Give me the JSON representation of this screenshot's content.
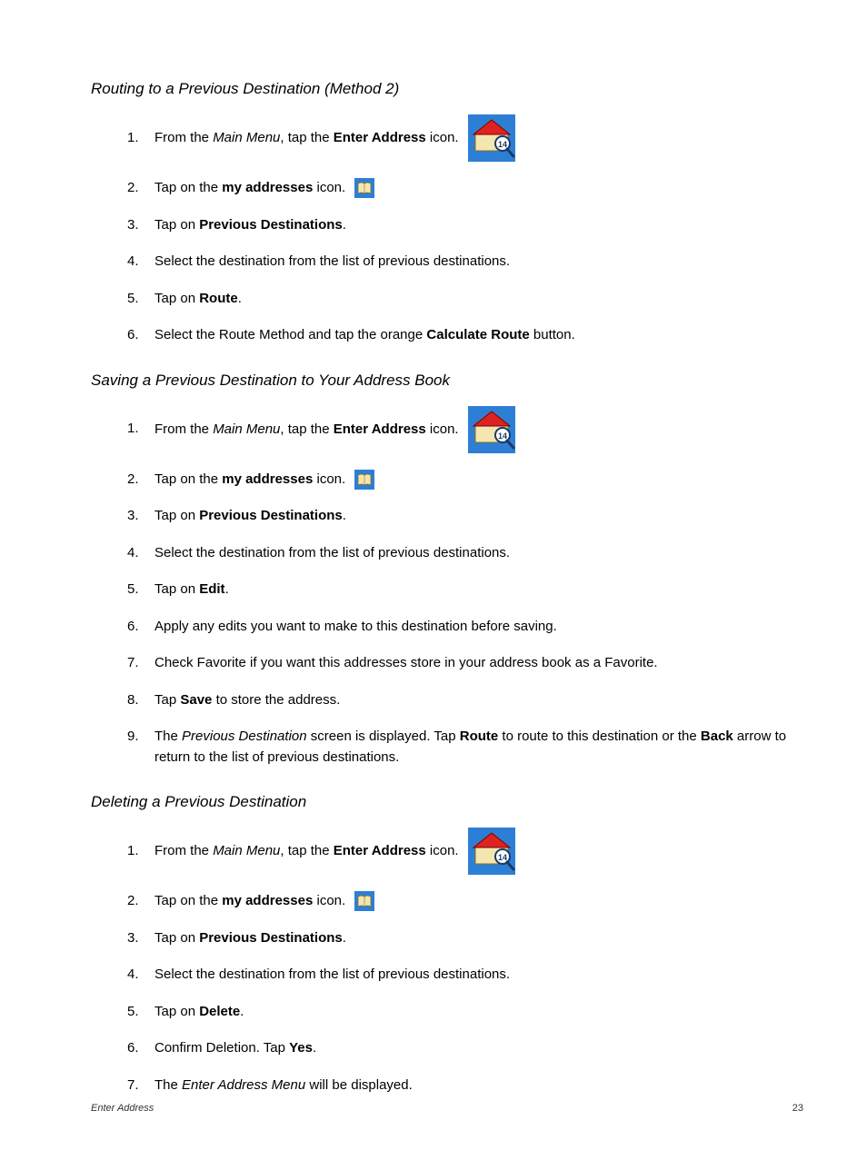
{
  "sections": [
    {
      "heading": "Routing to a Previous Destination (Method 2)",
      "steps": [
        {
          "num": "1.",
          "icon": "enter-address",
          "frags": [
            {
              "t": "From the "
            },
            {
              "t": "Main Menu",
              "cls": "ital"
            },
            {
              "t": ", tap the "
            },
            {
              "t": "Enter Address",
              "cls": "bold"
            },
            {
              "t": " icon."
            }
          ]
        },
        {
          "num": "2.",
          "icon": "my-addresses",
          "frags": [
            {
              "t": "Tap on the "
            },
            {
              "t": "my addresses",
              "cls": "bold"
            },
            {
              "t": " icon."
            }
          ]
        },
        {
          "num": "3.",
          "frags": [
            {
              "t": "Tap on "
            },
            {
              "t": "Previous Destinations",
              "cls": "bold"
            },
            {
              "t": "."
            }
          ]
        },
        {
          "num": "4.",
          "frags": [
            {
              "t": "Select the destination from the list of previous destinations."
            }
          ]
        },
        {
          "num": "5.",
          "frags": [
            {
              "t": "Tap on "
            },
            {
              "t": "Route",
              "cls": "bold"
            },
            {
              "t": "."
            }
          ]
        },
        {
          "num": "6.",
          "frags": [
            {
              "t": "Select the Route Method and tap the orange "
            },
            {
              "t": "Calculate Route",
              "cls": "bold"
            },
            {
              "t": " button."
            }
          ]
        }
      ]
    },
    {
      "heading": "Saving a Previous Destination to Your Address Book",
      "steps": [
        {
          "num": "1.",
          "icon": "enter-address",
          "frags": [
            {
              "t": "From the "
            },
            {
              "t": "Main Menu",
              "cls": "ital"
            },
            {
              "t": ", tap the "
            },
            {
              "t": "Enter Address",
              "cls": "bold"
            },
            {
              "t": " icon."
            }
          ]
        },
        {
          "num": "2.",
          "icon": "my-addresses",
          "frags": [
            {
              "t": "Tap on the "
            },
            {
              "t": "my addresses",
              "cls": "bold"
            },
            {
              "t": " icon."
            }
          ]
        },
        {
          "num": "3.",
          "frags": [
            {
              "t": "Tap on "
            },
            {
              "t": "Previous Destinations",
              "cls": "bold"
            },
            {
              "t": "."
            }
          ]
        },
        {
          "num": "4.",
          "frags": [
            {
              "t": "Select the destination from the list of previous destinations."
            }
          ]
        },
        {
          "num": "5.",
          "frags": [
            {
              "t": "Tap on "
            },
            {
              "t": "Edit",
              "cls": "bold"
            },
            {
              "t": "."
            }
          ]
        },
        {
          "num": "6.",
          "frags": [
            {
              "t": "Apply any edits you want to make to this destination before saving."
            }
          ]
        },
        {
          "num": "7.",
          "frags": [
            {
              "t": "Check Favorite if you want this addresses store in your address book as a Favorite."
            }
          ]
        },
        {
          "num": "8.",
          "frags": [
            {
              "t": "Tap "
            },
            {
              "t": "Save",
              "cls": "bold"
            },
            {
              "t": " to store the address."
            }
          ]
        },
        {
          "num": "9.",
          "frags": [
            {
              "t": "The "
            },
            {
              "t": "Previous Destination",
              "cls": "ital"
            },
            {
              "t": " screen is displayed.  Tap "
            },
            {
              "t": "Route",
              "cls": "bold"
            },
            {
              "t": " to route to this destination or the "
            },
            {
              "t": "Back",
              "cls": "bold"
            },
            {
              "t": " arrow to return to the list of previous destinations."
            }
          ]
        }
      ]
    },
    {
      "heading": "Deleting a Previous Destination",
      "steps": [
        {
          "num": "1.",
          "icon": "enter-address",
          "frags": [
            {
              "t": "From the "
            },
            {
              "t": "Main Menu",
              "cls": "ital"
            },
            {
              "t": ", tap the "
            },
            {
              "t": "Enter Address",
              "cls": "bold"
            },
            {
              "t": " icon."
            }
          ]
        },
        {
          "num": "2.",
          "icon": "my-addresses",
          "frags": [
            {
              "t": "Tap on the "
            },
            {
              "t": "my addresses",
              "cls": "bold"
            },
            {
              "t": " icon."
            }
          ]
        },
        {
          "num": "3.",
          "frags": [
            {
              "t": "Tap on "
            },
            {
              "t": "Previous Destinations",
              "cls": "bold"
            },
            {
              "t": "."
            }
          ]
        },
        {
          "num": "4.",
          "frags": [
            {
              "t": "Select the destination from the list of previous destinations."
            }
          ]
        },
        {
          "num": "5.",
          "frags": [
            {
              "t": "Tap on "
            },
            {
              "t": "Delete",
              "cls": "bold"
            },
            {
              "t": "."
            }
          ]
        },
        {
          "num": "6.",
          "frags": [
            {
              "t": "Confirm Deletion.  Tap "
            },
            {
              "t": "Yes",
              "cls": "bold"
            },
            {
              "t": "."
            }
          ]
        },
        {
          "num": "7.",
          "frags": [
            {
              "t": "The "
            },
            {
              "t": "Enter Address Menu",
              "cls": "ital"
            },
            {
              "t": " will be displayed."
            }
          ]
        }
      ]
    }
  ],
  "footer": {
    "left": "Enter Address",
    "right": "23"
  }
}
